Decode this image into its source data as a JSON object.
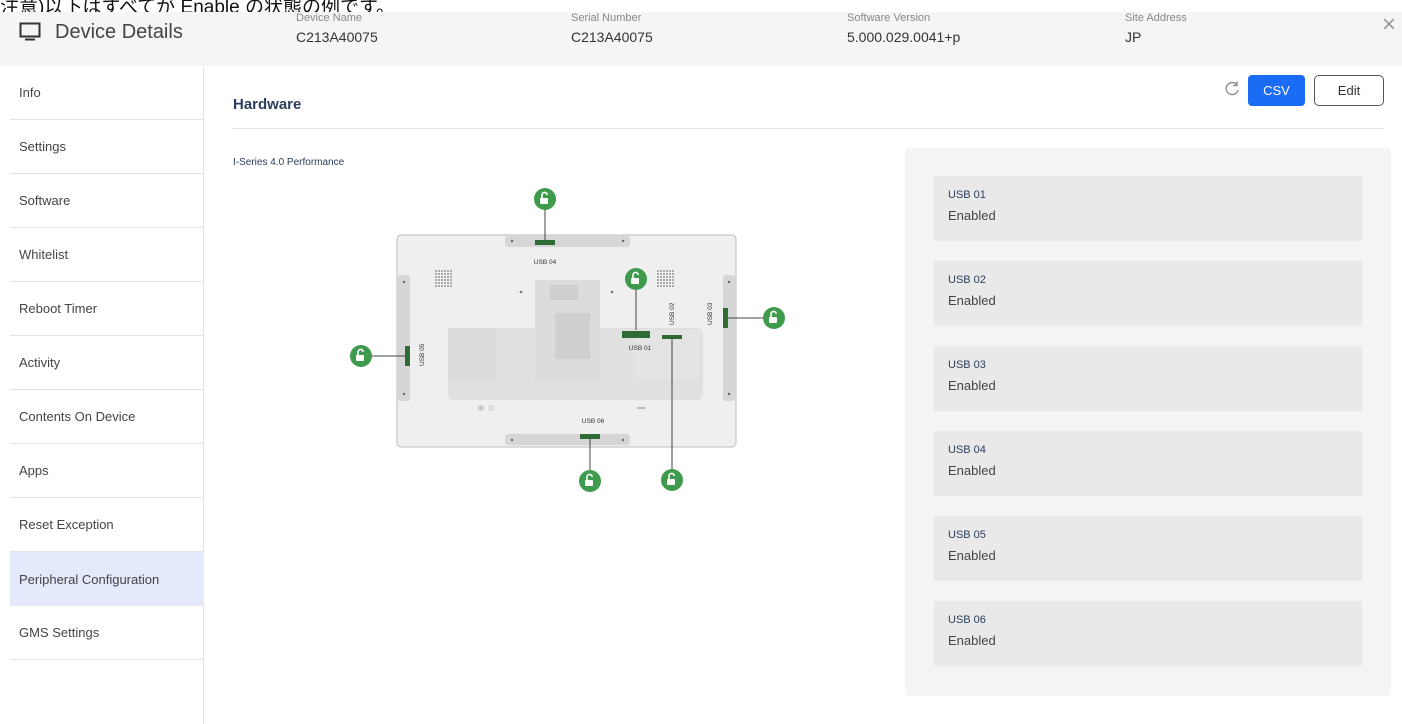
{
  "top_note": "注意)以下はすべてが Enable の状態の例です。",
  "header": {
    "title": "Device Details",
    "fields": [
      {
        "label": "Device Name",
        "value": "C213A40075"
      },
      {
        "label": "Serial Number",
        "value": "C213A40075"
      },
      {
        "label": "Software Version",
        "value": "5.000.029.0041+p"
      },
      {
        "label": "Site Address",
        "value": "JP"
      }
    ],
    "close_glyph": "×"
  },
  "sidebar": {
    "items": [
      {
        "label": "Info"
      },
      {
        "label": "Settings"
      },
      {
        "label": "Software"
      },
      {
        "label": "Whitelist"
      },
      {
        "label": "Reboot Timer"
      },
      {
        "label": "Activity"
      },
      {
        "label": "Contents On Device"
      },
      {
        "label": "Apps"
      },
      {
        "label": "Reset Exception"
      },
      {
        "label": "Peripheral Configuration",
        "active": true
      },
      {
        "label": "GMS Settings"
      }
    ]
  },
  "content": {
    "title": "Hardware",
    "csv_label": "CSV",
    "edit_label": "Edit",
    "model_name": "I-Series 4.0 Performance"
  },
  "diagram": {
    "port_labels": [
      "USB 01",
      "USB 02",
      "USB 03",
      "USB 04",
      "USB 05",
      "USB 06"
    ],
    "lock_state": "unlocked",
    "accent_color": "#3e9a4c"
  },
  "usb_ports": [
    {
      "name": "USB 01",
      "status": "Enabled"
    },
    {
      "name": "USB 02",
      "status": "Enabled"
    },
    {
      "name": "USB 03",
      "status": "Enabled"
    },
    {
      "name": "USB 04",
      "status": "Enabled"
    },
    {
      "name": "USB 05",
      "status": "Enabled"
    },
    {
      "name": "USB 06",
      "status": "Enabled"
    }
  ]
}
